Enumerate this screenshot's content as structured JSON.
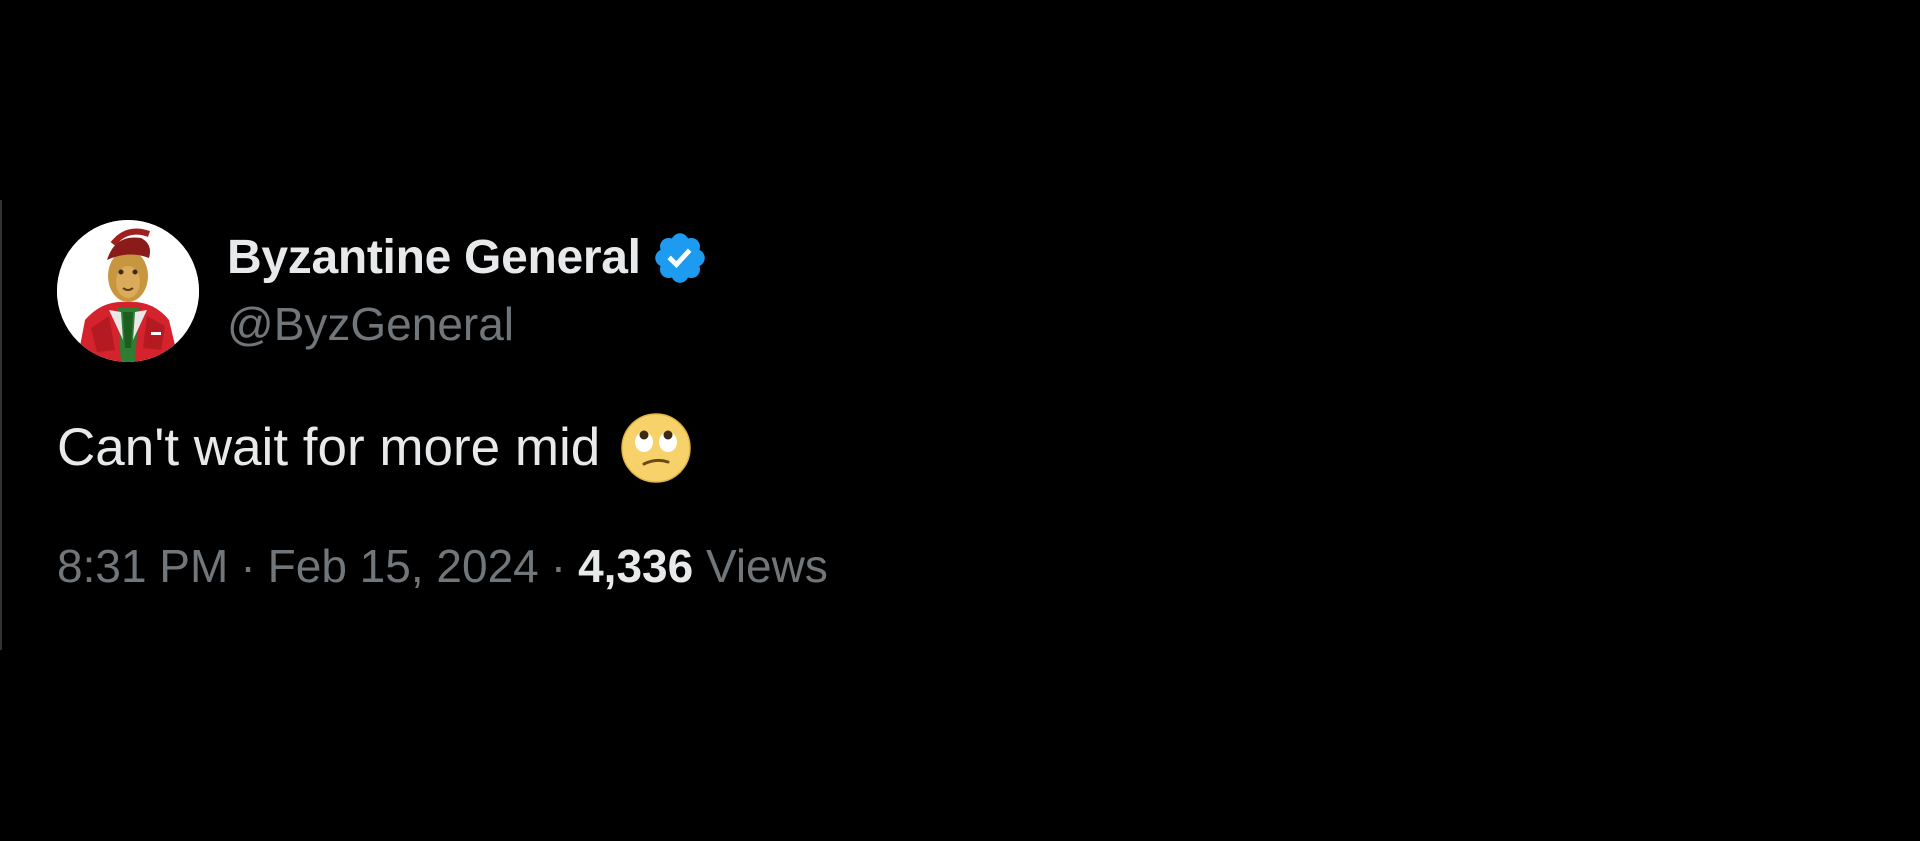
{
  "tweet": {
    "display_name": "Byzantine General",
    "handle": "@ByzGeneral",
    "verified": true,
    "verified_color": "#1d9bf0",
    "avatar_icon": "lion-general-avatar",
    "text": "Can't wait for more mid",
    "emoji": "face-with-rolling-eyes-icon",
    "time": "8:31 PM",
    "separator": "·",
    "date": "Feb 15, 2024",
    "views_count": "4,336",
    "views_label": "Views"
  },
  "colors": {
    "background": "#000000",
    "primary_text": "#e7e9ea",
    "secondary_text": "#71767b"
  }
}
